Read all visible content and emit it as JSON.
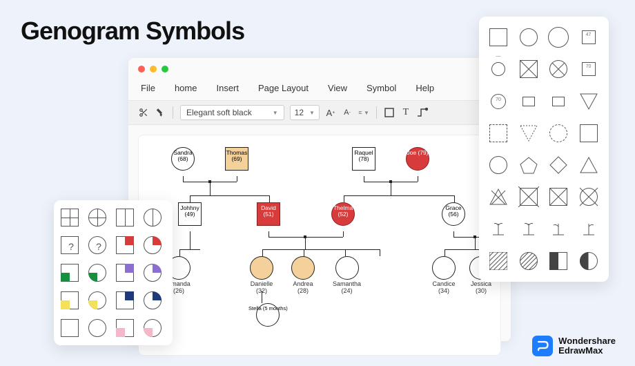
{
  "page_title": "Genogram Symbols",
  "menu": [
    "File",
    "home",
    "Insert",
    "Page Layout",
    "View",
    "Symbol",
    "Help"
  ],
  "toolbar": {
    "font": "Elegant soft black",
    "size": "12"
  },
  "nodes": {
    "sandra": {
      "name": "Sandra",
      "age": "(68)"
    },
    "thomas": {
      "name": "Thomas",
      "age": "(69)"
    },
    "raquel": {
      "name": "Raquel",
      "age": "(78)"
    },
    "joe": {
      "name": "Joe (79)"
    },
    "johhny": {
      "name": "Johhny",
      "age": "(49)"
    },
    "david": {
      "name": "David",
      "age": "(51)"
    },
    "thelma": {
      "name": "Thelma",
      "age": "(52)"
    },
    "grace": {
      "name": "Grace",
      "age": "(56)"
    },
    "amanda": {
      "name": "Amanda",
      "age": "(26)"
    },
    "danielle": {
      "name": "Danielle",
      "age": "(32)"
    },
    "andrea": {
      "name": "Andrea",
      "age": "(28)"
    },
    "samantha": {
      "name": "Samantha",
      "age": "(24)"
    },
    "candice": {
      "name": "Candice",
      "age": "(34)"
    },
    "jessica": {
      "name": "Jessica",
      "age": "(30)"
    },
    "stella": {
      "name": "Stella (5 months)"
    }
  },
  "right_panel_labels": {
    "r0c3": "47",
    "r1c3": "70",
    "r2c0": "70"
  },
  "brand": {
    "line1": "Wondershare",
    "line2": "EdrawMax"
  }
}
